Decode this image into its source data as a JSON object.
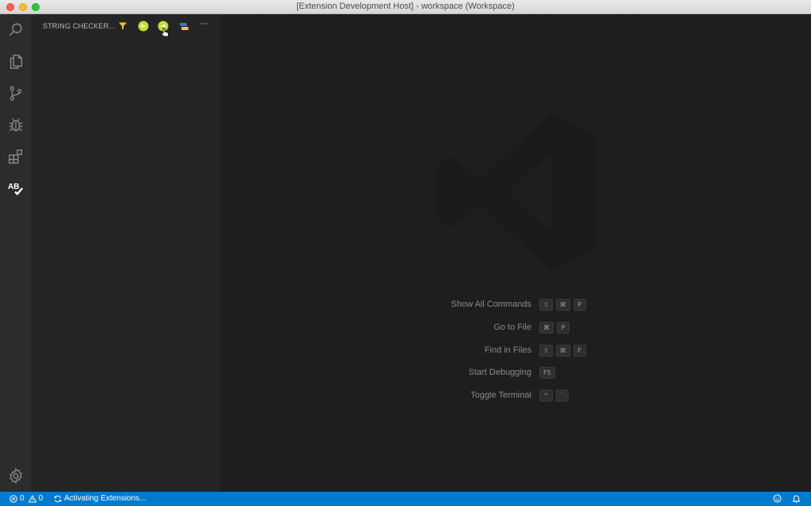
{
  "window": {
    "title": "[Extension Development Host] - workspace (Workspace)"
  },
  "activity_bar": {
    "items": [
      {
        "icon": "search-icon"
      },
      {
        "icon": "explorer-icon"
      },
      {
        "icon": "source-control-icon"
      },
      {
        "icon": "debug-icon"
      },
      {
        "icon": "extensions-icon"
      },
      {
        "icon": "string-checker-icon",
        "label": "AB"
      },
      {
        "icon": "settings-gear-icon"
      }
    ]
  },
  "sidebar": {
    "title": "STRING CHECKER...",
    "actions": [
      {
        "icon": "filter-icon",
        "color": "#f5c518"
      },
      {
        "icon": "back-icon",
        "color": "#c6dc3a"
      },
      {
        "icon": "forward-icon",
        "color": "#c6dc3a"
      },
      {
        "icon": "python-icon"
      },
      {
        "icon": "more-actions-icon",
        "label": "···"
      }
    ]
  },
  "editor": {
    "shortcuts": [
      {
        "label": "Show All Commands",
        "keys": [
          "⇧",
          "⌘",
          "P"
        ]
      },
      {
        "label": "Go to File",
        "keys": [
          "⌘",
          "P"
        ]
      },
      {
        "label": "Find in Files",
        "keys": [
          "⇧",
          "⌘",
          "F"
        ]
      },
      {
        "label": "Start Debugging",
        "keys": [
          "F5"
        ]
      },
      {
        "label": "Toggle Terminal",
        "keys": [
          "^",
          "`"
        ]
      }
    ]
  },
  "statusbar": {
    "errors": "0",
    "warnings": "0",
    "activity": "Activating Extensions...",
    "color": "#007acc"
  }
}
